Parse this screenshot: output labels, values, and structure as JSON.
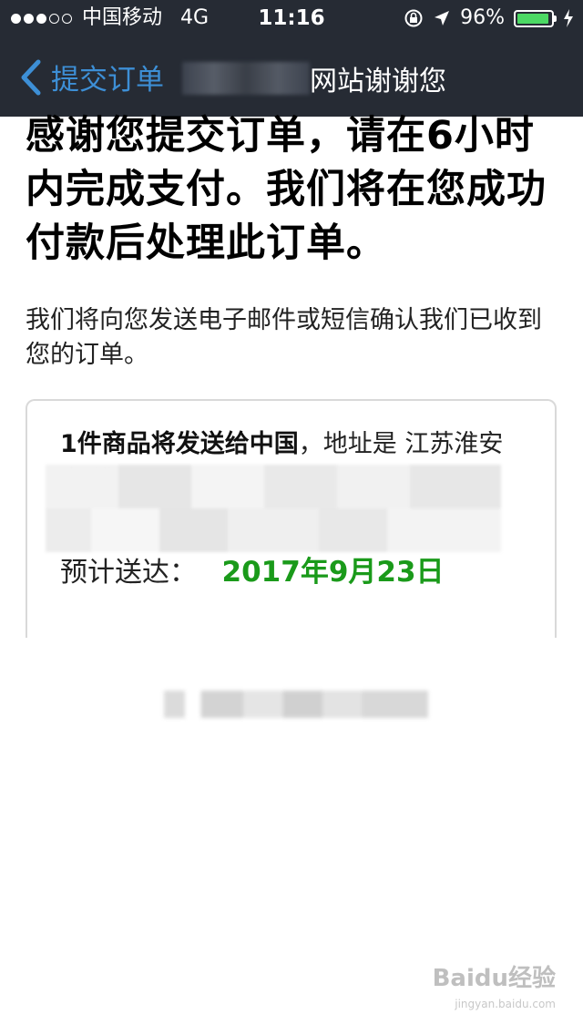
{
  "status_bar": {
    "carrier": "中国移动",
    "network": "4G",
    "time": "11:16",
    "battery_percent": "96%",
    "battery_level": 0.96
  },
  "nav": {
    "back_label": "提交订单",
    "title_visible": "网站谢谢您"
  },
  "content": {
    "headline": "感谢您提交订单，请在6小时内完成支付。我们将在您成功付款后处理此订单。",
    "subtext": "我们将向您发送电子邮件或短信确认我们已收到您的订单。",
    "shipping_bold": "1件商品将发送给中国",
    "shipping_address_prefix": "，地址是 江苏淮安市 淮",
    "eta_label": "预计送达：",
    "eta_date": "2017年9月23日"
  },
  "watermark": {
    "brand": "Baidu经验",
    "url": "jingyan.baidu.com"
  },
  "colors": {
    "nav_bg": "#262b34",
    "back_accent": "#3d8fd6",
    "date_green": "#1a9a1a",
    "battery_green": "#4cd964"
  }
}
